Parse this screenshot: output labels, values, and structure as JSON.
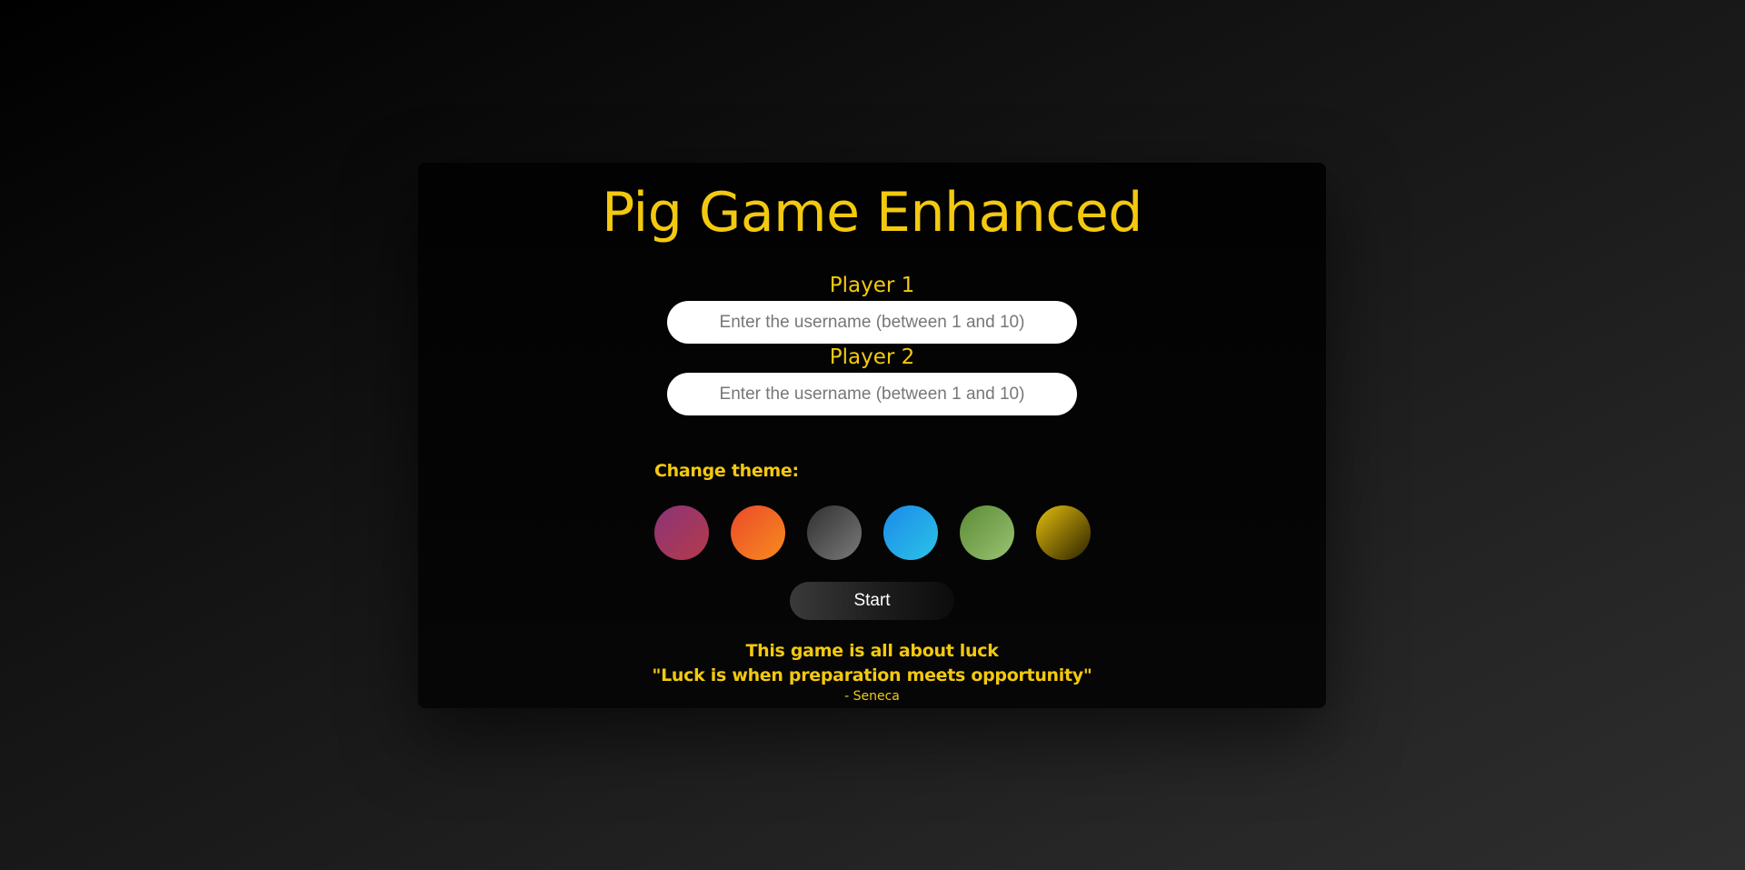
{
  "title": "Pig Game Enhanced",
  "players": [
    {
      "label": "Player 1",
      "value": "",
      "placeholder": "Enter the username (between 1 and 10)"
    },
    {
      "label": "Player 2",
      "value": "",
      "placeholder": "Enter the username (between 1 and 10)"
    }
  ],
  "theme": {
    "label": "Change theme:",
    "swatches": [
      {
        "name": "purple-red",
        "colors": [
          "#8b3478",
          "#b53a4a"
        ]
      },
      {
        "name": "orange",
        "colors": [
          "#ea4a2c",
          "#f88b1c"
        ]
      },
      {
        "name": "gray",
        "colors": [
          "#303030",
          "#7a7a7a"
        ]
      },
      {
        "name": "blue",
        "colors": [
          "#1b8ae8",
          "#2cc3e8"
        ]
      },
      {
        "name": "green",
        "colors": [
          "#5c8a34",
          "#99c474"
        ]
      },
      {
        "name": "gold",
        "colors": [
          "#e3bd0c",
          "#2b2200"
        ]
      }
    ]
  },
  "start_label": "Start",
  "quote": {
    "line1": "This game is all about luck",
    "line2": "\"Luck is when preparation meets opportunity\"",
    "author": "- Seneca"
  },
  "colors": {
    "accent": "#f3c90f",
    "card_bg": "#040404",
    "input_bg": "#ffffff"
  }
}
